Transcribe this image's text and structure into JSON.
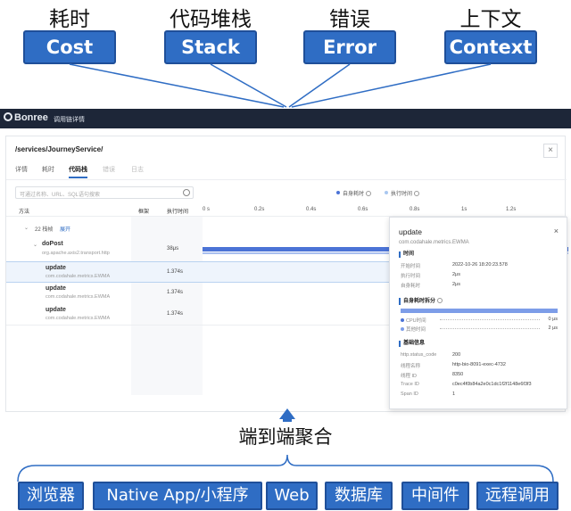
{
  "top_labels": [
    {
      "cn": "耗时",
      "en": "Cost"
    },
    {
      "cn": "代码堆栈",
      "en": "Stack"
    },
    {
      "cn": "错误",
      "en": "Error"
    },
    {
      "cn": "上下文",
      "en": "Context"
    }
  ],
  "app": {
    "logo": "Bonree",
    "title": "调用链详情"
  },
  "panel": {
    "path": "/services/JourneyService/",
    "close": "×",
    "tabs": [
      "详情",
      "耗时",
      "代码栈",
      "错误",
      "日志"
    ],
    "search_placeholder": "可通过名称、URL、SQL语句搜索",
    "legend_self": "自身耗时",
    "legend_exec": "执行时间",
    "col_method": "方法",
    "col_frame": "框架",
    "col_duration": "执行时间",
    "ticks": [
      "0 s",
      "0.2s",
      "0.4s",
      "0.6s",
      "0.8s",
      "1s",
      "1.2s"
    ],
    "group_label": "22 栈帧",
    "group_expand": "展开",
    "rows": [
      {
        "title": "doPost",
        "sub": "org.apache.axis2.transport.http",
        "dur": "38μs"
      },
      {
        "title": "update",
        "sub": "com.codahale.metrics.EWMA",
        "dur": "1.374s"
      },
      {
        "title": "update",
        "sub": "com.codahale.metrics.EWMA",
        "dur": "1.374s"
      },
      {
        "title": "update",
        "sub": "com.codahale.metrics.EWMA",
        "dur": "1.374s"
      }
    ]
  },
  "popup": {
    "title": "update",
    "subtitle": "com.codahale.metrics.EWMA",
    "sec_time": "时间",
    "time_rows": [
      {
        "k": "开始时间",
        "v": "2022-10-26 18:20:23.578"
      },
      {
        "k": "执行时间",
        "v": "2μs"
      },
      {
        "k": "自身耗时",
        "v": "2μs"
      }
    ],
    "sec_self": "自身耗时拆分",
    "self_rows": [
      {
        "k": "CPU时间",
        "v": "0 μs"
      },
      {
        "k": "其他时间",
        "v": "2 μs"
      }
    ],
    "sec_basic": "基础信息",
    "basic_rows": [
      {
        "k": "http.status_code",
        "v": "200"
      },
      {
        "k": "线程名称",
        "v": "http-bio-8091-exec-4732"
      },
      {
        "k": "线程 ID",
        "v": "8350"
      },
      {
        "k": "Trace ID",
        "v": "c0ec4f0b84a2e0c1dc1f2f1148e6f3f3"
      },
      {
        "k": "Span ID",
        "v": "1"
      }
    ]
  },
  "bottom": {
    "title": "端到端聚合",
    "boxes": [
      "浏览器",
      "Native App/小程序",
      "Web",
      "数据库",
      "中间件",
      "远程调用"
    ]
  }
}
